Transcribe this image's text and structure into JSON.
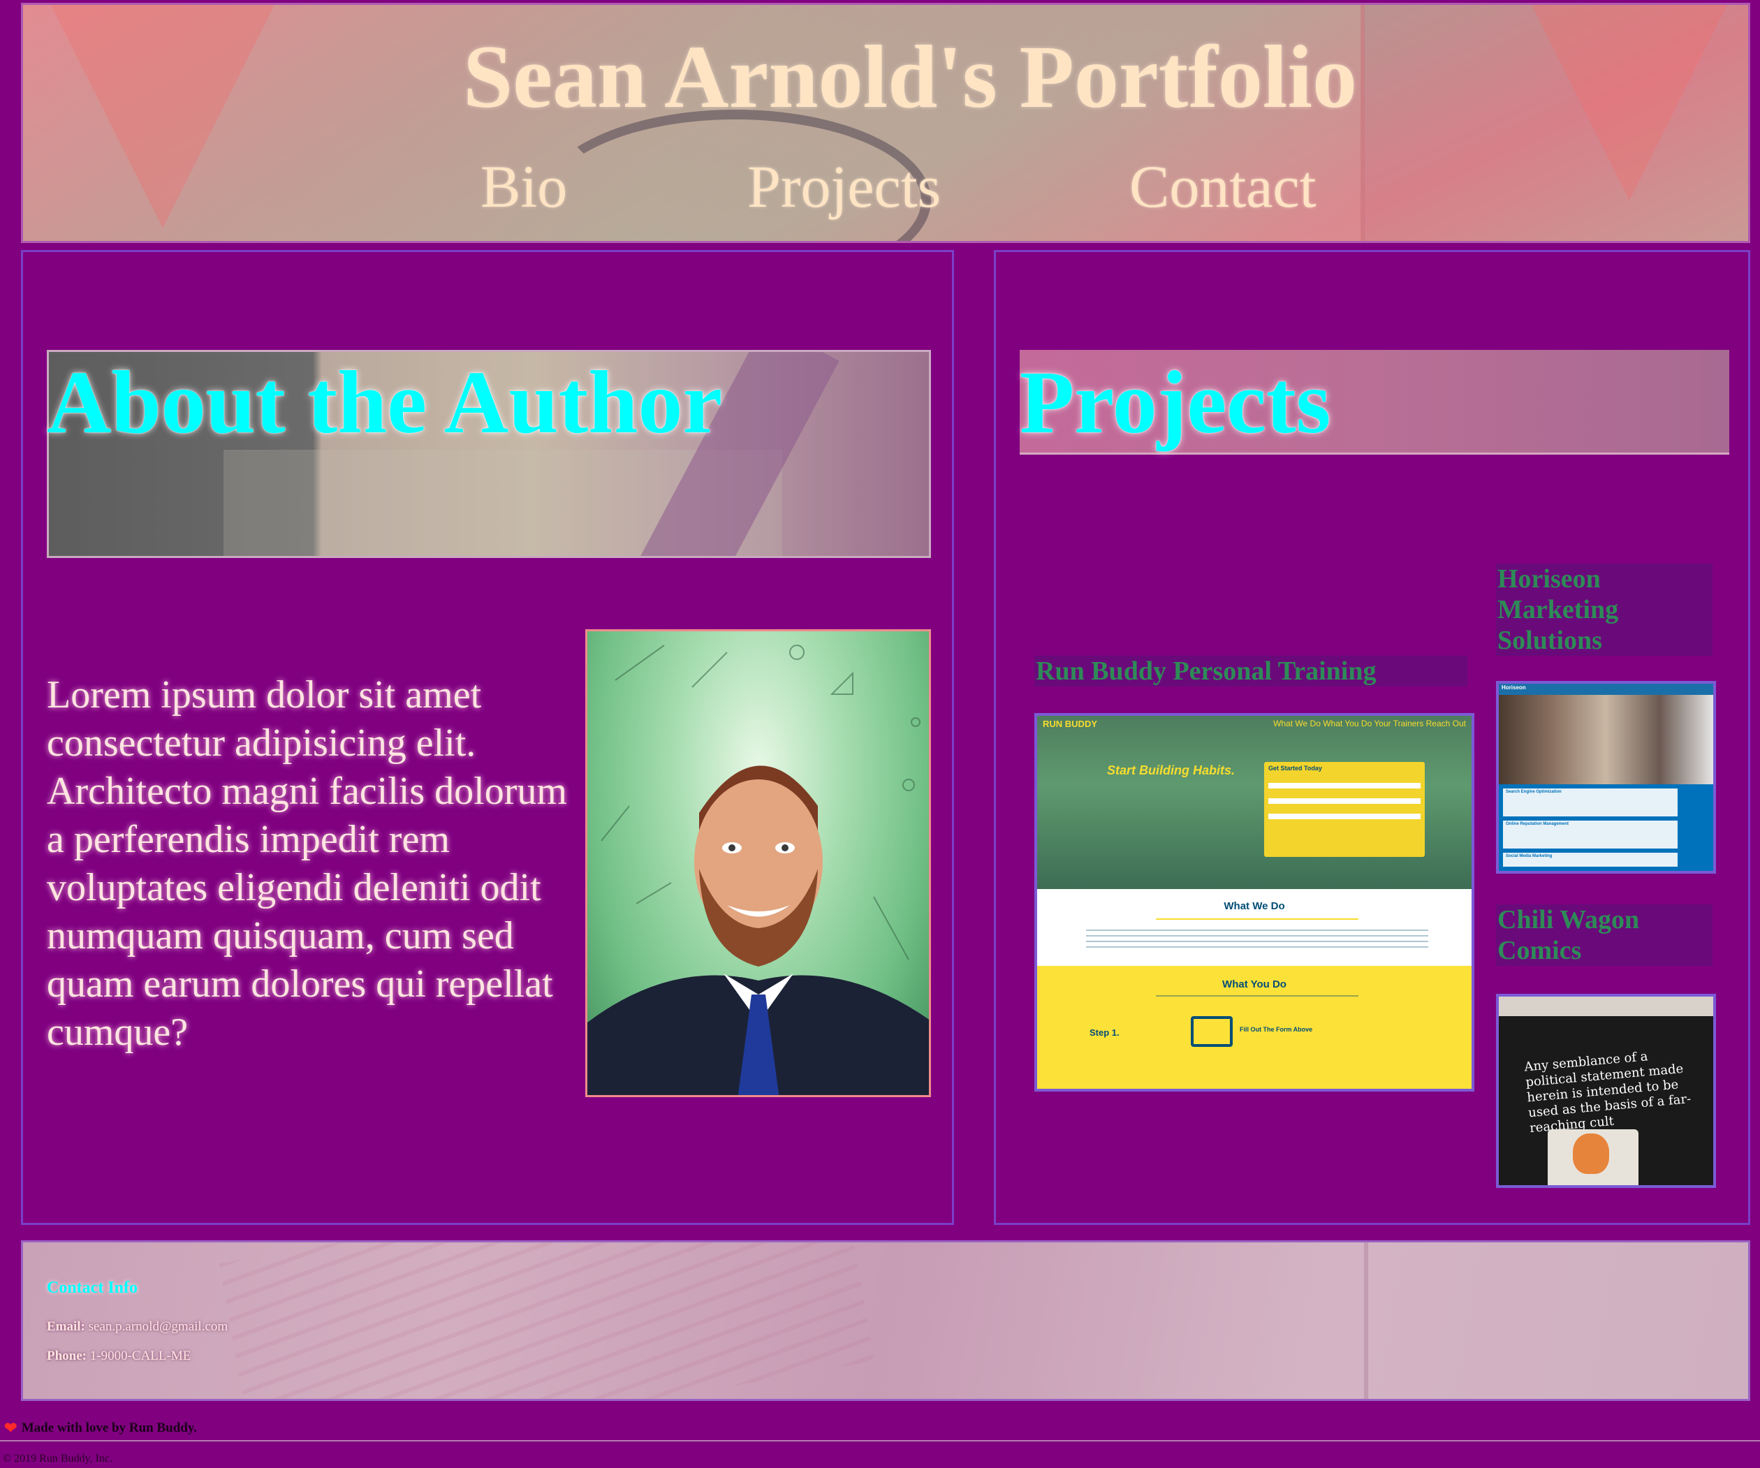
{
  "header": {
    "title": "Sean Arnold's Portfolio",
    "nav": [
      "Bio",
      "Projects",
      "Contact"
    ]
  },
  "about": {
    "heading": "About the Author",
    "text": "Lorem ipsum dolor sit amet consectetur adipisicing elit. Architecto magni facilis dolorum a perferendis impedit rem voluptates eligendi deleniti odit numquam quisquam, cum sed quam earum dolores qui repellat cumque?"
  },
  "projects": {
    "heading": "Projects",
    "items": [
      {
        "label": "Run Buddy Personal Training",
        "mock": {
          "brand": "RUN BUDDY",
          "menu": "What We Do   What You Do   Your Trainers   Reach Out",
          "hero": "Start Building Habits.",
          "form_title": "Get Started Today",
          "section1": "What We Do",
          "section2": "What You Do",
          "step": "Step 1.",
          "step_text": "Fill Out The Form Above"
        }
      },
      {
        "label": "Horiseon Marketing Solutions",
        "mock": {
          "brand": "Horiseon",
          "card1": "Search Engine Optimization",
          "card2": "Online Reputation Management",
          "card3": "Social Media Marketing"
        }
      },
      {
        "label": "Chili Wagon Comics",
        "mock": {
          "text": "Any semblance of a political statement made herein is intended to be used as the basis of a far-reaching cult"
        }
      }
    ]
  },
  "footer": {
    "contact_title": "Contact Info",
    "email_label": "Email:",
    "email": "sean.p.arnold@gmail.com",
    "phone_label": "Phone:",
    "phone": "1-9000-CALL-ME"
  },
  "made_with": "Made with love by Run Buddy.",
  "copyright": "© 2019 Run Buddy, Inc."
}
